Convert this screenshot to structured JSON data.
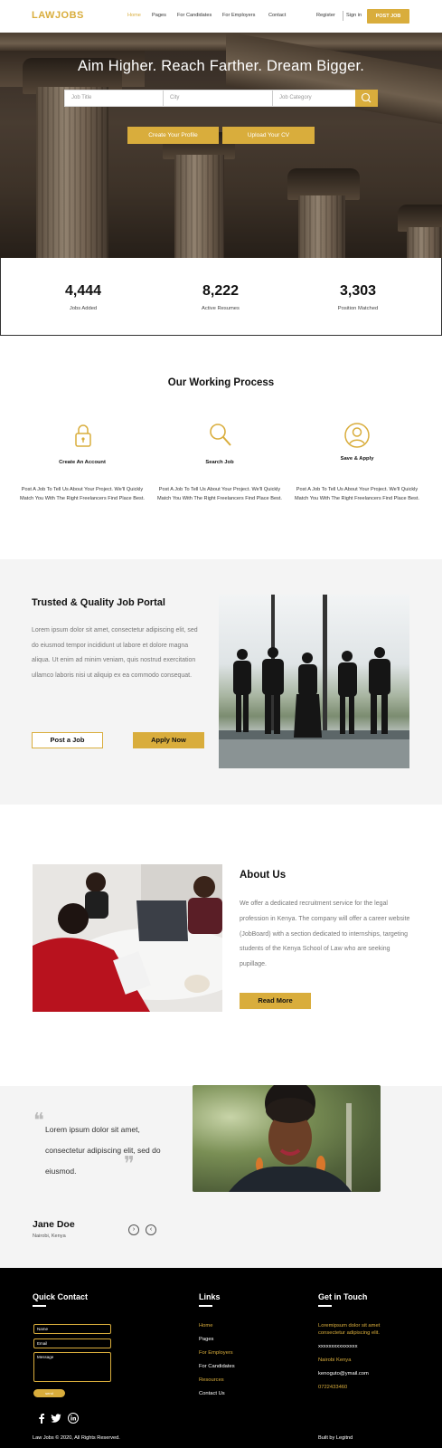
{
  "brand": {
    "logo": "LAWJOBS",
    "accent": "#d9ad3c"
  },
  "nav": {
    "links": [
      "Home",
      "Pages",
      "For Candidates",
      "For Employers",
      "Contact"
    ],
    "active": "Home",
    "register": "Register",
    "sign_in": "Sign in",
    "post_job": "POST JOB"
  },
  "hero": {
    "title": "Aim Higher. Reach Farther. Dream Bigger.",
    "search": {
      "job_title_placeholder": "Job Title",
      "city_placeholder": "City",
      "category_placeholder": "Job Category",
      "button_icon": "search-icon"
    },
    "create_profile": "Create Your Profile",
    "upload_cv": "Upload Your CV"
  },
  "stats": [
    {
      "value": "4,444",
      "label": "Jobs Added"
    },
    {
      "value": "8,222",
      "label": "Active Resumes"
    },
    {
      "value": "3,303",
      "label": "Position Matched"
    }
  ],
  "process": {
    "title": "Our Working Process",
    "steps": [
      {
        "icon": "lock-icon",
        "title": "Create An Account",
        "desc": "Post A Job To Tell Us About Your Project. We'll Quickly Match You With The Right Freelancers Find Place Best."
      },
      {
        "icon": "search-icon",
        "title": "Search Job",
        "desc": "Post A Job To Tell Us About Your Project. We'll Quickly Match You With The Right Freelancers Find Place Best."
      },
      {
        "icon": "user-icon",
        "title": "Save & Apply",
        "desc": "Post A Job To Tell Us About Your Project. We'll Quickly Match You With The Right Freelancers Find Place Best."
      }
    ]
  },
  "trusted": {
    "title": "Trusted & Quality Job Portal",
    "desc": "Lorem ipsum dolor sit amet, consectetur adipiscing elit, sed do eiusmod tempor incididunt ut labore et dolore magna aliqua. Ut enim ad minim veniam, quis nostrud exercitation ullamco laboris nisi ut aliquip ex ea commodo consequat.",
    "post_job": "Post a Job",
    "apply_now": "Apply Now"
  },
  "about": {
    "title": "About Us",
    "desc": "We offer a dedicated recruitment service for the legal profession in Kenya. The company will offer a career website (JobBoard) with a section dedicated to internships, targeting students of the Kenya School of Law who are seeking pupillage.",
    "read_more": "Read More"
  },
  "testimonial": {
    "quote": "Lorem ipsum dolor sit amet, consectetur adipiscing elit, sed do eiusmod.",
    "name": "Jane Doe",
    "location": "Nairobi, Kenya",
    "next_icon": "chevron-right-icon",
    "prev_icon": "chevron-left-icon"
  },
  "footer": {
    "quick_contact": {
      "title": "Quick Contact",
      "name_placeholder": "Name",
      "email_placeholder": "Email",
      "message_placeholder": "Message",
      "send": "send"
    },
    "social": [
      "facebook-icon",
      "twitter-icon",
      "linkedin-icon"
    ],
    "links": {
      "title": "Links",
      "items": [
        {
          "label": "Home",
          "highlight": true
        },
        {
          "label": "Pages",
          "highlight": false
        },
        {
          "label": "For Employers",
          "highlight": true
        },
        {
          "label": "For Candidates",
          "highlight": false
        },
        {
          "label": "Resources",
          "highlight": true
        },
        {
          "label": "Contact Us",
          "highlight": false
        }
      ]
    },
    "get_in_touch": {
      "title": "Get in Touch",
      "tagline": "Loremipsum dolor sit amet consectetur adipiscing elit.",
      "phone_masked": "xxxxxxxxxxxxxxx",
      "city": "Nairobi Kenya",
      "email": "kenoguto@ymail.com",
      "phone": "0722433460"
    },
    "copyright": "Law Jobs © 2020, All Rights Reserved.",
    "built_by": "Built by Legitnd"
  }
}
